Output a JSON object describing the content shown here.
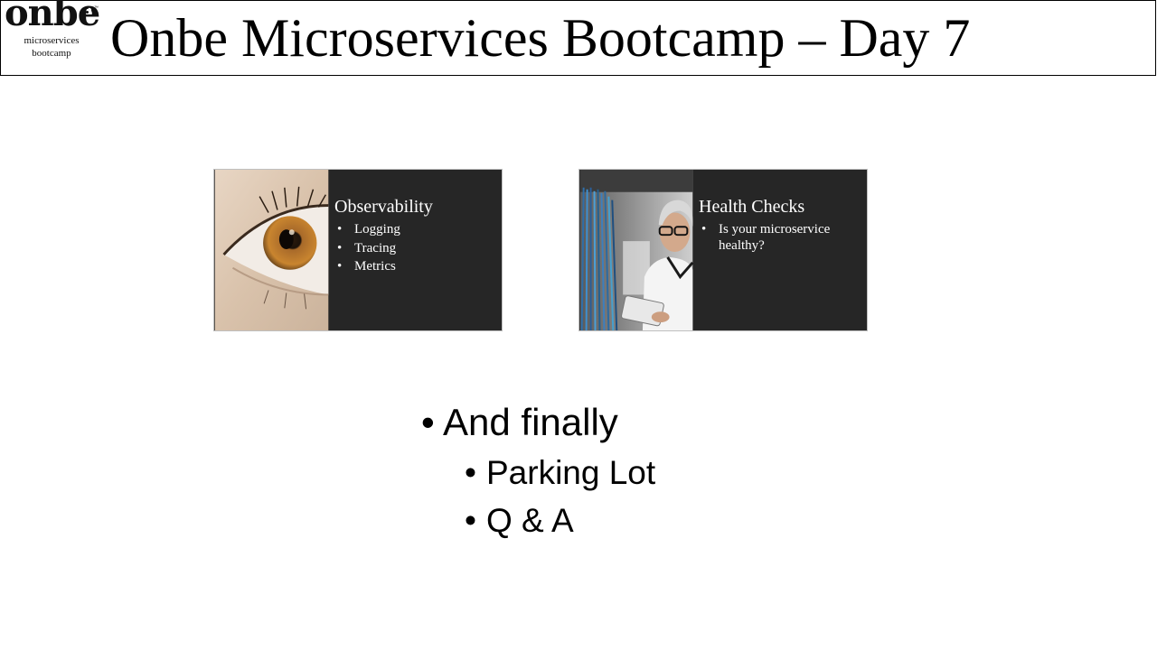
{
  "header": {
    "logo_word": "onbe",
    "logo_tm": "™",
    "logo_sub_line1": "microservices",
    "logo_sub_line2": "bootcamp",
    "title": "Onbe Microservices Bootcamp – Day 7"
  },
  "thumbnails": [
    {
      "title": "Observability",
      "items": [
        "Logging",
        "Tracing",
        "Metrics"
      ]
    },
    {
      "title": "Health Checks",
      "items": [
        "Is your microservice healthy?"
      ]
    }
  ],
  "bullets": {
    "main": "And finally",
    "sub": [
      "Parking Lot",
      "Q & A"
    ]
  }
}
